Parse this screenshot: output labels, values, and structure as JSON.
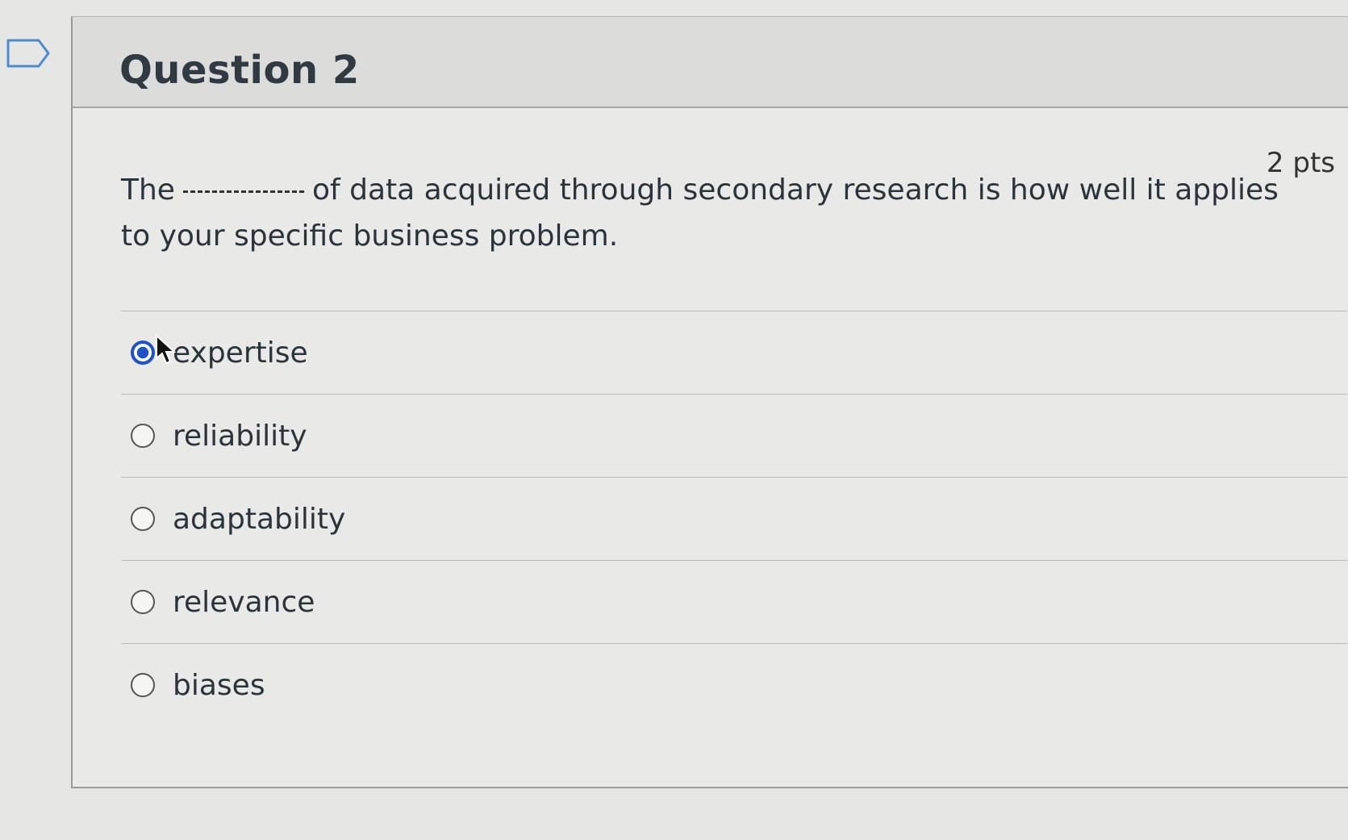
{
  "question": {
    "title": "Question 2",
    "points": "2 pts",
    "text_before": "The",
    "text_after": "of data acquired through secondary research is how well it applies to your specific business problem."
  },
  "answers": [
    {
      "label": "expertise",
      "selected": true
    },
    {
      "label": "reliability",
      "selected": false
    },
    {
      "label": "adaptability",
      "selected": false
    },
    {
      "label": "relevance",
      "selected": false
    },
    {
      "label": "biases",
      "selected": false
    }
  ],
  "colors": {
    "selected_radio": "#1d52c8"
  },
  "icons": {
    "flag": "flag-bookmark-icon",
    "cursor": "mouse-pointer-icon"
  }
}
